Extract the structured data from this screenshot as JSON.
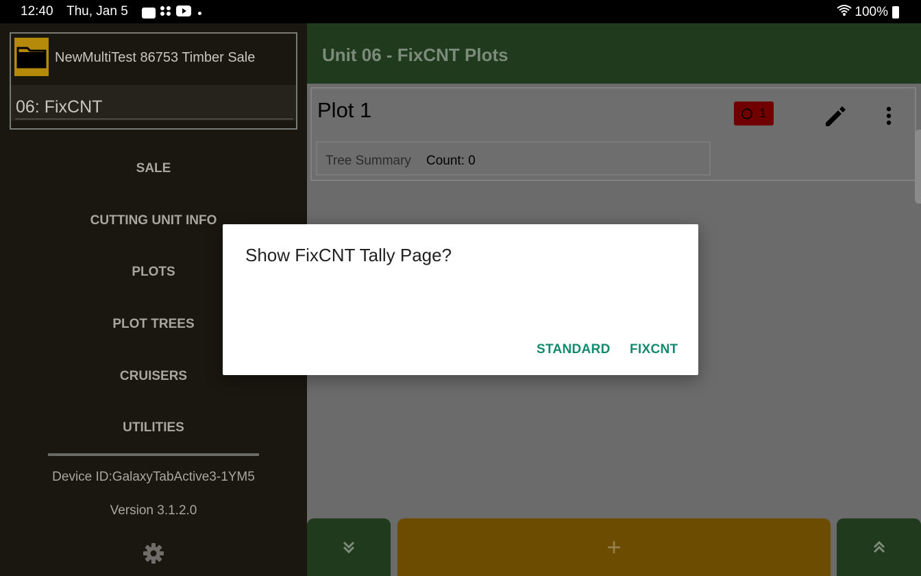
{
  "status_bar": {
    "time": "12:40",
    "date": "Thu, Jan 5",
    "notification_icons": [
      "image-notification-icon",
      "apps-notification-icon",
      "youtube-icon"
    ],
    "battery": "100%"
  },
  "drawer": {
    "sale_name": "NewMultiTest 86753 Timber Sale",
    "unit_name": "06: FixCNT",
    "nav_items": [
      "SALE",
      "CUTTING UNIT INFO",
      "PLOTS",
      "PLOT TREES",
      "CRUISERS",
      "UTILITIES"
    ],
    "device_id": "Device ID:GalaxyTabActive3-1YM5",
    "version": "Version 3.1.2.0"
  },
  "main": {
    "title": "Unit 06 - FixCNT Plots",
    "plot": {
      "title": "Plot  1",
      "error_count": "1",
      "summary_label": "Tree Summary",
      "summary_count": "Count: 0"
    },
    "add_label": "+"
  },
  "dialog": {
    "title": "Show FixCNT Tally Page?",
    "buttons": {
      "standard": "STANDARD",
      "fixcnt": "FIXCNT"
    }
  },
  "colors": {
    "app_bar": "#1f3a1d",
    "accent_button": "#128a6e",
    "add_button": "#6b4c00",
    "drawer_bg": "#1a1610",
    "error_badge": "#700000"
  }
}
